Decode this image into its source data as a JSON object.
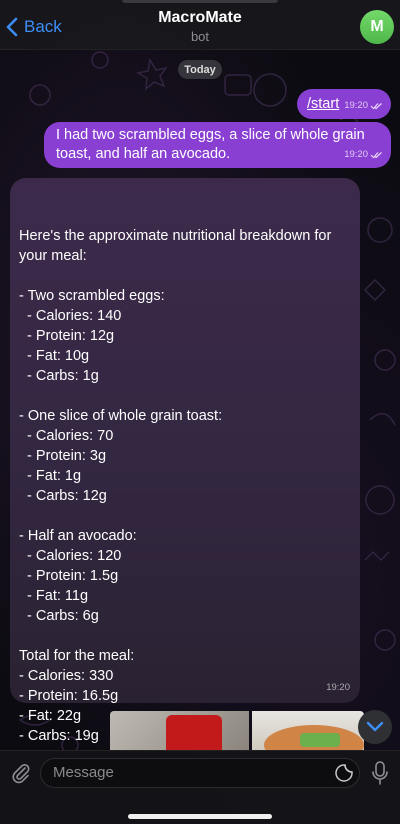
{
  "header": {
    "back_label": "Back",
    "title": "MacroMate",
    "subtitle": "bot",
    "avatar_letter": "M"
  },
  "date_divider": "Today",
  "messages": {
    "outgoing_1": {
      "text": "/start",
      "time": "19:20"
    },
    "outgoing_2": {
      "text": "I had two scrambled eggs, a slice of whole grain\ntoast, and half an avocado.",
      "time": "19:20"
    },
    "incoming_1": {
      "text": "Here's the approximate nutritional breakdown for\nyour meal:\n\n- Two scrambled eggs:\n  - Calories: 140\n  - Protein: 12g\n  - Fat: 10g\n  - Carbs: 1g\n\n- One slice of whole grain toast:\n  - Calories: 70\n  - Protein: 3g\n  - Fat: 1g\n  - Carbs: 12g\n\n- Half an avocado:\n  - Calories: 120\n  - Protein: 1.5g\n  - Fat: 11g\n  - Carbs: 6g\n\nTotal for the meal:\n- Calories: 330\n- Protein: 16.5g\n- Fat: 22g\n- Carbs: 19g",
      "time": "19:20"
    }
  },
  "composer": {
    "placeholder": "Message"
  },
  "colors": {
    "accent": "#3e8ef7",
    "outgoing_bubble": "#8a3fd3",
    "avatar": "#5fc855"
  },
  "icons": [
    "back-chevron-icon",
    "double-check-icon",
    "chevron-down-icon",
    "paperclip-icon",
    "sticker-icon",
    "microphone-icon"
  ]
}
